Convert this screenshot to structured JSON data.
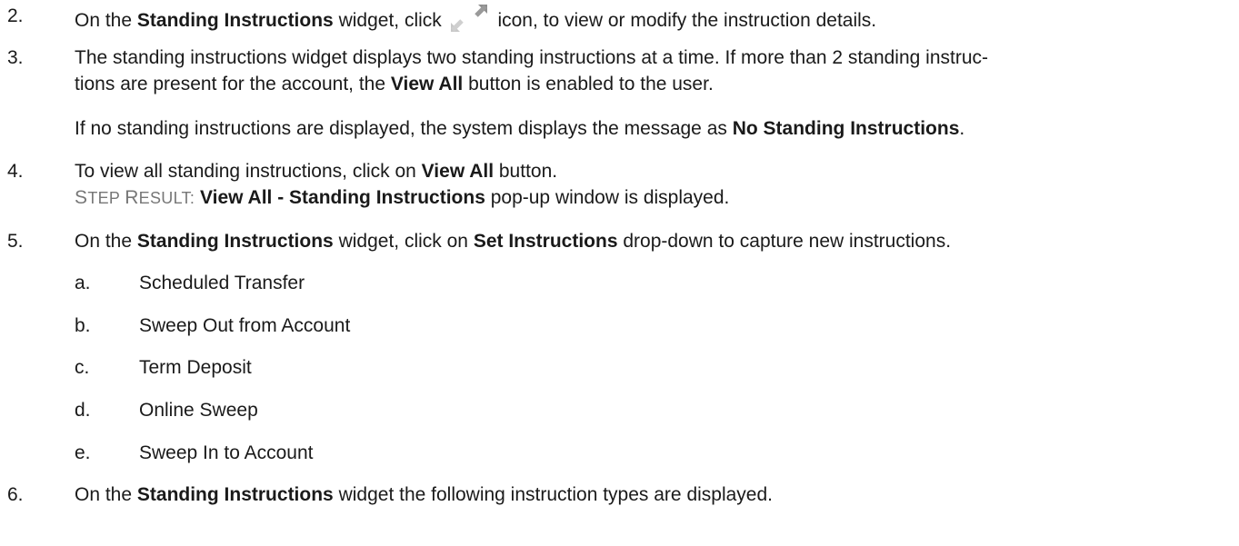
{
  "steps": [
    {
      "num": "2.",
      "segments": [
        {
          "t": "On the ",
          "b": false
        },
        {
          "t": "Standing Instructions",
          "b": true
        },
        {
          "t": " widget, click ",
          "b": false
        },
        {
          "icon": "expand-arrows-icon"
        },
        {
          "t": " icon, to view or modify the instruction details.",
          "b": false
        }
      ]
    },
    {
      "num": "3.",
      "segments": [
        {
          "t": "The standing instructions widget displays two standing instructions at a time. If more than 2 standing instruc-",
          "b": false
        }
      ],
      "cont": [
        {
          "t": "tions are present for the account, the ",
          "b": false
        },
        {
          "t": "View All",
          "b": true
        },
        {
          "t": " button is enabled to the user.",
          "b": false
        }
      ],
      "para": [
        {
          "t": "If no standing instructions are displayed, the system displays the message as ",
          "b": false
        },
        {
          "t": "No Standing Instructions",
          "b": true
        },
        {
          "t": ".",
          "b": false
        }
      ]
    },
    {
      "num": "4.",
      "segments": [
        {
          "t": "To view all standing instructions, click on ",
          "b": false
        },
        {
          "t": "View All",
          "b": true
        },
        {
          "t": " button.",
          "b": false
        }
      ],
      "step_result": {
        "label": "Step Result:",
        "segments": [
          {
            "t": "View All - Standing Instructions",
            "b": true
          },
          {
            "t": " pop-up window is displayed.",
            "b": false
          }
        ]
      }
    },
    {
      "num": "5.",
      "segments": [
        {
          "t": "On the ",
          "b": false
        },
        {
          "t": "Standing Instructions",
          "b": true
        },
        {
          "t": " widget, click on ",
          "b": false
        },
        {
          "t": "Set Instructions",
          "b": true
        },
        {
          "t": " drop-down to capture new instructions.",
          "b": false
        }
      ]
    },
    {
      "num": "6.",
      "segments": [
        {
          "t": "On the ",
          "b": false
        },
        {
          "t": "Standing Instructions",
          "b": true
        },
        {
          "t": " widget the following instruction types are displayed.",
          "b": false
        }
      ]
    }
  ],
  "substeps": [
    {
      "letter": "a.",
      "label": "Scheduled Transfer"
    },
    {
      "letter": "b.",
      "label": "Sweep Out from Account"
    },
    {
      "letter": "c.",
      "label": "Term Deposit"
    },
    {
      "letter": "d.",
      "label": "Online Sweep"
    },
    {
      "letter": "e.",
      "label": "Sweep In to Account"
    }
  ],
  "colors": {
    "text": "#1a1a1a",
    "step_result_label": "#777777",
    "icon": "#bdbdbd"
  }
}
